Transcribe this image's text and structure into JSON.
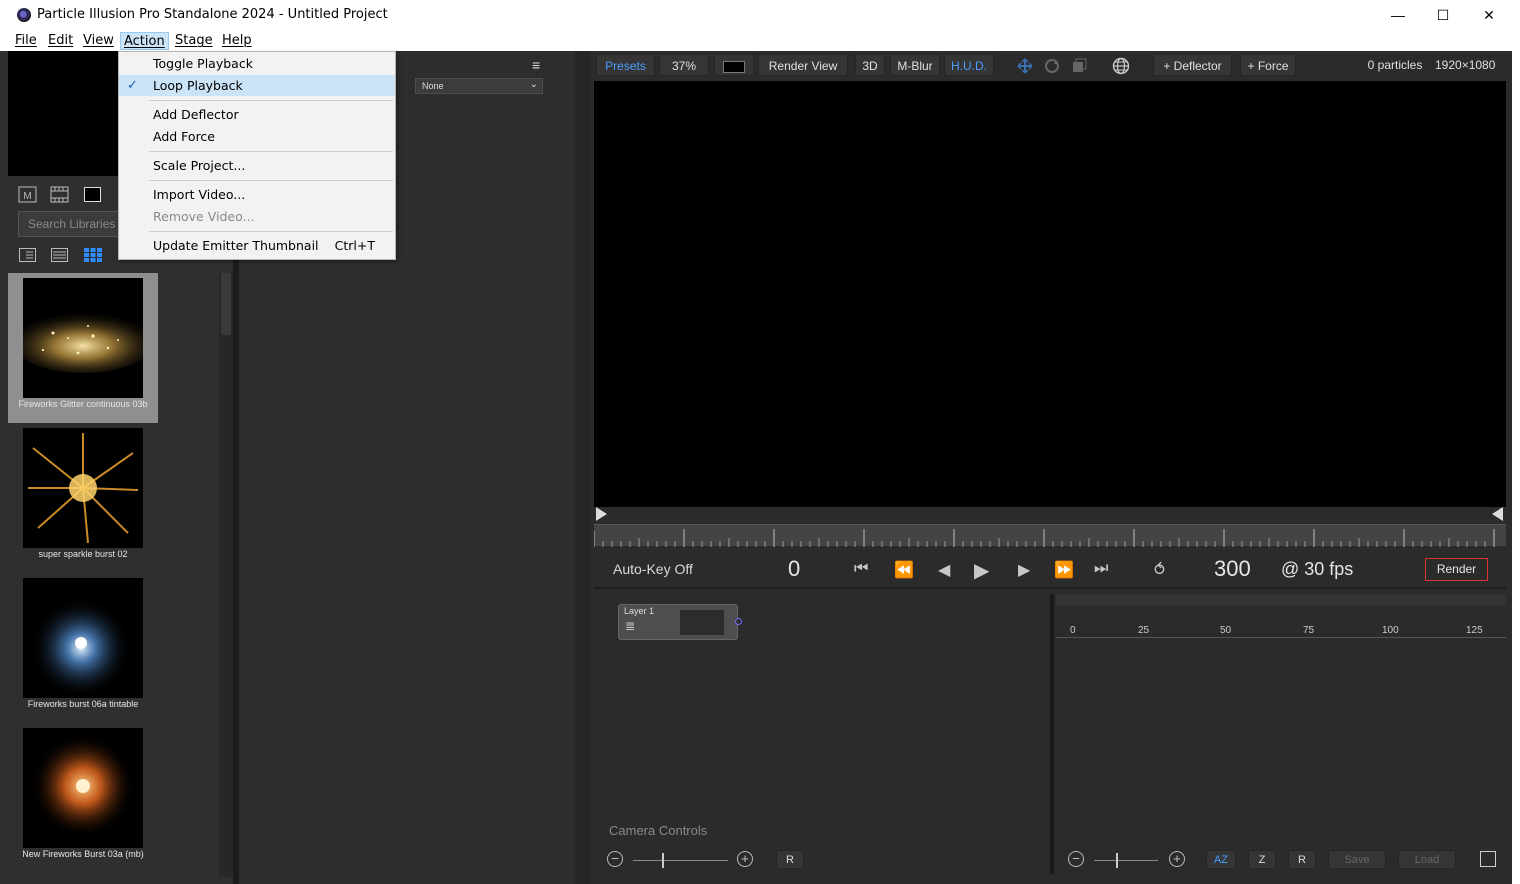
{
  "window": {
    "title": "Particle Illusion Pro Standalone 2024 - Untitled Project",
    "minimize_glyph": "—",
    "maximize_glyph": "☐",
    "close_glyph": "✕"
  },
  "menubar": {
    "items": [
      "File",
      "Edit",
      "View",
      "Action",
      "Stage",
      "Help"
    ],
    "active": "Action"
  },
  "action_menu": {
    "items": [
      {
        "label": "Toggle Playback",
        "checked": false,
        "disabled": false,
        "shortcut": ""
      },
      {
        "label": "Loop Playback",
        "checked": true,
        "disabled": false,
        "shortcut": ""
      },
      {
        "label": "Add Deflector",
        "checked": false,
        "disabled": false,
        "shortcut": ""
      },
      {
        "label": "Add Force",
        "checked": false,
        "disabled": false,
        "shortcut": ""
      },
      {
        "label": "Scale Project...",
        "checked": false,
        "disabled": false,
        "shortcut": ""
      },
      {
        "label": "Import Video...",
        "checked": false,
        "disabled": false,
        "shortcut": ""
      },
      {
        "label": "Remove Video...",
        "checked": false,
        "disabled": true,
        "shortcut": ""
      },
      {
        "label": "Update Emitter Thumbnail",
        "checked": false,
        "disabled": false,
        "shortcut": "Ctrl+T"
      }
    ],
    "check_glyph": "✓"
  },
  "library": {
    "search_placeholder": "Search Libraries ...",
    "top_icons": [
      "mode-m-icon",
      "film-strip-icon",
      "black-square-icon"
    ],
    "view_icons": [
      "detail-view-icon",
      "list-view-icon",
      "grid-view-icon"
    ],
    "thumbnails": [
      {
        "caption": "Fireworks Glitter continuous 03b",
        "selected": true,
        "palette": [
          "#f4e3a8",
          "#b89040",
          "#5a4520"
        ]
      },
      {
        "caption": "super sparkle burst 02",
        "selected": false,
        "palette": [
          "#ffd36b",
          "#e09a2a",
          "#6a3e08"
        ]
      },
      {
        "caption": "Fireworks burst 06a tintable",
        "selected": false,
        "palette": [
          "#e8f3ff",
          "#5c9ee8",
          "#13335a"
        ]
      },
      {
        "caption": "New Fireworks Burst 03a (mb)",
        "selected": false,
        "palette": [
          "#ffd08a",
          "#e0661e",
          "#5a1f05"
        ]
      }
    ]
  },
  "mid_panel": {
    "menu_glyph": "≡",
    "select_value": "None",
    "select_chevron": "⌄"
  },
  "toolbar": {
    "presets": "Presets",
    "zoom": "37%",
    "render_view": "Render View",
    "btn_3d": "3D",
    "mblur": "M-Blur",
    "hud": "H.U.D.",
    "add_deflector": "+ Deflector",
    "add_force": "+ Force",
    "particle_count": "0 particles",
    "resolution": "1920×1080"
  },
  "transport": {
    "autokey": "Auto-Key Off",
    "current_frame": "0",
    "end_frame": "300",
    "fps": "@ 30 fps",
    "render": "Render",
    "icons": {
      "first": "⏮",
      "rewind": "⏪",
      "step_back": "◀",
      "play": "▶",
      "step_fwd": "▶",
      "ffwd": "⏩",
      "last": "⏭",
      "loop": "⥀"
    }
  },
  "node_graph": {
    "layer_label": "Layer 1",
    "layer_menu_glyph": "≣",
    "camera_controls": "Camera Controls"
  },
  "timeline": {
    "ticks": [
      "0",
      "25",
      "50",
      "75",
      "100",
      "125"
    ]
  },
  "bottom_bar": {
    "zoom_out": "−",
    "zoom_in": "+",
    "reset": "R",
    "az": "AZ",
    "z": "Z",
    "r": "R",
    "save": "Save",
    "load": "Load"
  }
}
